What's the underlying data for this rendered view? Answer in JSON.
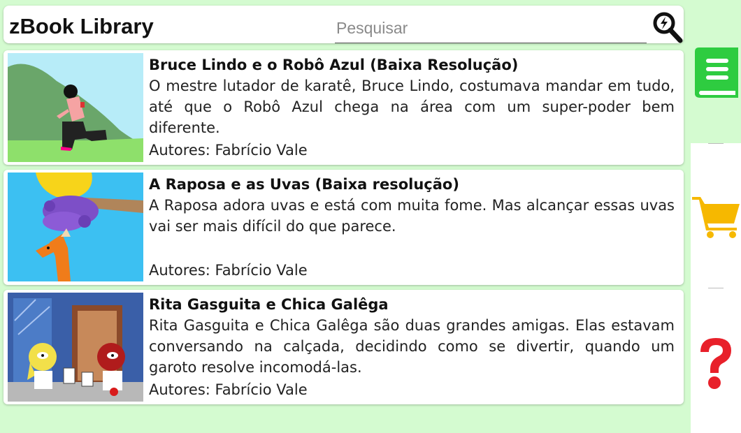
{
  "header": {
    "title": "zBook Library",
    "search_placeholder": "Pesquisar"
  },
  "books": [
    {
      "title": "Bruce Lindo e o Robô Azul (Baixa Resolução)",
      "description": "O mestre lutador de karatê, Bruce Lindo, costumava mandar em tudo, até que o Robô Azul chega na área com um super-poder bem diferente.",
      "authors": "Autores: Fabrício Vale"
    },
    {
      "title": "A Raposa e as Uvas (Baixa resolução)",
      "description": "A Raposa adora uvas e está com muita fome. Mas alcançar essas uvas vai ser mais difícil do que parece.",
      "authors": "Autores: Fabrício Vale"
    },
    {
      "title": "Rita Gasguita e Chica Galêga",
      "description": "Rita Gasguita e Chica Galêga são duas grandes amigas. Elas estavam conversando na calçada, decidindo como se divertir, quando um garoto resolve incomodá-las.",
      "authors": "Autores: Fabrício Vale"
    }
  ],
  "sidebar": {
    "items": [
      {
        "icon": "book-icon",
        "color": "#2ecc40"
      },
      {
        "icon": "cart-icon",
        "color": "#f6b800"
      },
      {
        "icon": "help-icon",
        "color": "#e8202a"
      }
    ]
  },
  "colors": {
    "background": "#d4fbd0",
    "card": "#ffffff"
  }
}
